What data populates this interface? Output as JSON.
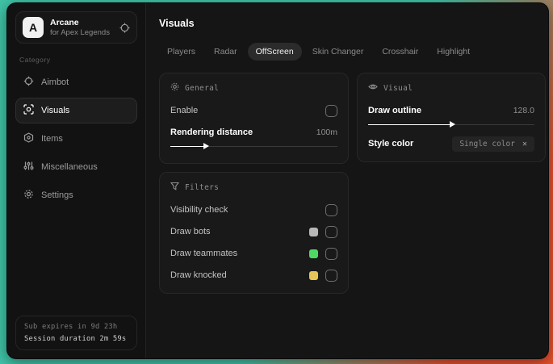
{
  "sidebar": {
    "brand": {
      "initial": "A",
      "title": "Arcane",
      "subtitle": "for Apex Legends"
    },
    "category_label": "Category",
    "items": [
      {
        "label": "Aimbot",
        "icon": "crosshair-icon",
        "selected": false
      },
      {
        "label": "Visuals",
        "icon": "scan-icon",
        "selected": true
      },
      {
        "label": "Items",
        "icon": "cube-icon",
        "selected": false
      },
      {
        "label": "Miscellaneous",
        "icon": "sliders-icon",
        "selected": false
      },
      {
        "label": "Settings",
        "icon": "gear-icon",
        "selected": false
      }
    ],
    "footer": {
      "line1": "Sub expires in 9d 23h",
      "line2": "Session duration 2m 59s"
    }
  },
  "header": {
    "title": "Visuals"
  },
  "tabs": [
    {
      "label": "Players",
      "selected": false
    },
    {
      "label": "Radar",
      "selected": false
    },
    {
      "label": "OffScreen",
      "selected": true
    },
    {
      "label": "Skin Changer",
      "selected": false
    },
    {
      "label": "Crosshair",
      "selected": false
    },
    {
      "label": "Highlight",
      "selected": false
    }
  ],
  "panels": {
    "general": {
      "title": "General",
      "icon": "sun-icon",
      "enable_label": "Enable",
      "enable_checked": false,
      "distance_label": "Rendering distance",
      "distance_value": "100m",
      "distance_percent": 21
    },
    "visual": {
      "title": "Visual",
      "icon": "eye-icon",
      "outline_label": "Draw outline",
      "outline_value": "128.0",
      "outline_percent": 50,
      "style_label": "Style color",
      "style_value": "Single color"
    },
    "filters": {
      "title": "Filters",
      "icon": "funnel-icon",
      "rows": [
        {
          "label": "Visibility check",
          "swatch": "",
          "checked": false
        },
        {
          "label": "Draw bots",
          "swatch": "#b8b8b8",
          "checked": false
        },
        {
          "label": "Draw teammates",
          "swatch": "#4fd964",
          "checked": false
        },
        {
          "label": "Draw knocked",
          "swatch": "#e3c657",
          "checked": false
        }
      ]
    }
  },
  "colors": {
    "desktop_teal": "#40c4a8",
    "desktop_orange": "#e8512e",
    "window_bg": "#151515",
    "panel_bg": "#191919",
    "accent_selected_tab": "#2b2b2b"
  }
}
